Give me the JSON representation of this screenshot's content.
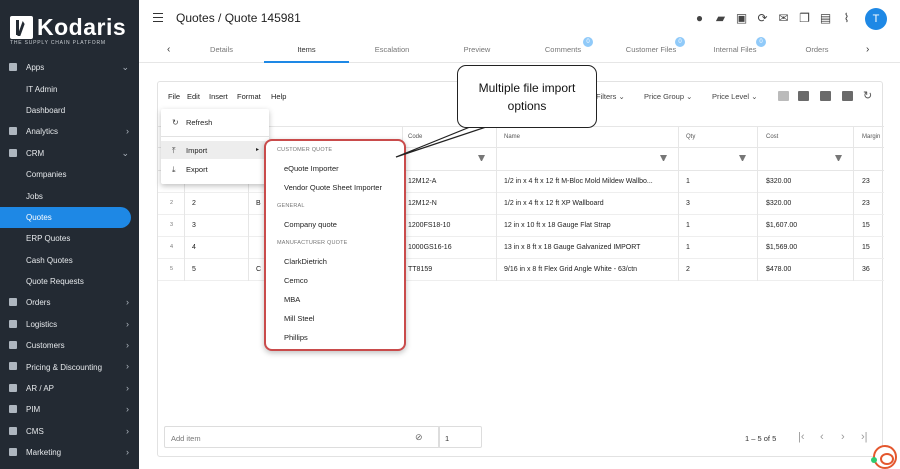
{
  "brand": {
    "name": "Kodaris",
    "tagline": "THE SUPPLY CHAIN PLATFORM"
  },
  "sidebar": {
    "items": [
      {
        "label": "Apps",
        "sub": false,
        "chev": "⌄"
      },
      {
        "label": "IT Admin",
        "sub": true
      },
      {
        "label": "Dashboard",
        "sub": true
      },
      {
        "label": "Analytics",
        "sub": false,
        "chev": "›"
      },
      {
        "label": "CRM",
        "sub": false,
        "chev": "⌄"
      },
      {
        "label": "Companies",
        "sub": true
      },
      {
        "label": "Jobs",
        "sub": true
      },
      {
        "label": "Quotes",
        "sub": true,
        "active": true
      },
      {
        "label": "ERP Quotes",
        "sub": true
      },
      {
        "label": "Cash Quotes",
        "sub": true
      },
      {
        "label": "Quote Requests",
        "sub": true
      },
      {
        "label": "Orders",
        "sub": false,
        "chev": "›"
      },
      {
        "label": "Logistics",
        "sub": false,
        "chev": "›"
      },
      {
        "label": "Customers",
        "sub": false,
        "chev": "›"
      },
      {
        "label": "Pricing & Discounting",
        "sub": false,
        "chev": "›"
      },
      {
        "label": "AR / AP",
        "sub": false,
        "chev": "›"
      },
      {
        "label": "PIM",
        "sub": false,
        "chev": "›"
      },
      {
        "label": "CMS",
        "sub": false,
        "chev": "›"
      },
      {
        "label": "Marketing",
        "sub": false,
        "chev": "›"
      }
    ]
  },
  "header": {
    "breadcrumb": "Quotes / Quote 145981",
    "avatar": "T"
  },
  "tabs": [
    {
      "label": "Details"
    },
    {
      "label": "Items",
      "active": true
    },
    {
      "label": "Escalation"
    },
    {
      "label": "Preview"
    },
    {
      "label": "Comments",
      "badge": "0"
    },
    {
      "label": "Customer Files",
      "badge": "0"
    },
    {
      "label": "Internal Files",
      "badge": "0"
    },
    {
      "label": "Orders"
    }
  ],
  "toolbar": {
    "menus": [
      "File",
      "Edit",
      "Insert",
      "Format",
      "Help"
    ],
    "filters": "Filters",
    "price_group": "Price Group",
    "price_level": "Price Level"
  },
  "grid": {
    "columns": [
      "Code",
      "Name",
      "Qty",
      "Cost",
      "Margin"
    ],
    "rows": [
      {
        "idx": "1",
        "line": "1",
        "pre": "B",
        "code": "12M12-A",
        "name": "1/2 in x 4 ft x 12 ft M-Bloc Mold Mildew Wallbo...",
        "qty": "1",
        "cost": "$320.00",
        "margin": "23"
      },
      {
        "idx": "2",
        "line": "2",
        "pre": "B",
        "code": "12M12-N",
        "name": "1/2 in x 4 ft x 12 ft XP Wallboard",
        "qty": "3",
        "cost": "$320.00",
        "margin": "23"
      },
      {
        "idx": "3",
        "line": "3",
        "pre": "",
        "code": "1200FS18-10",
        "name": "12 in x 10 ft x 18 Gauge Flat Strap",
        "qty": "1",
        "cost": "$1,607.00",
        "margin": "15"
      },
      {
        "idx": "4",
        "line": "4",
        "pre": "",
        "code": "1000GS16-16",
        "name": "13 in x 8 ft x 18 Gauge Galvanized IMPORT",
        "qty": "1",
        "cost": "$1,569.00",
        "margin": "15"
      },
      {
        "idx": "5",
        "line": "5",
        "pre": "C",
        "code": "TT8159",
        "name": "9/16 in x 8 ft Flex Grid Angle White - 63/ctn",
        "qty": "2",
        "cost": "$478.00",
        "margin": "36"
      }
    ]
  },
  "footer": {
    "add_item": "Add item",
    "qty": "1",
    "pager": "1 – 5 of 5"
  },
  "file_menu": {
    "refresh": "Refresh",
    "import": "Import",
    "export": "Export"
  },
  "import_menu": {
    "group1": "CUSTOMER QUOTE",
    "i1": "eQuote Importer",
    "i2": "Vendor Quote Sheet Importer",
    "group2": "GENERAL",
    "i3": "Company quote",
    "group3": "MANUFACTURER QUOTE",
    "i4": "ClarkDietrich",
    "i5": "Cemco",
    "i6": "MBA",
    "i7": "Mill Steel",
    "i8": "Phillips"
  },
  "callout": {
    "text": "Multiple file import options"
  },
  "colors": {
    "accent": "#1e88e5",
    "sidebar": "#232a33",
    "highlight": "#c94b4b"
  }
}
